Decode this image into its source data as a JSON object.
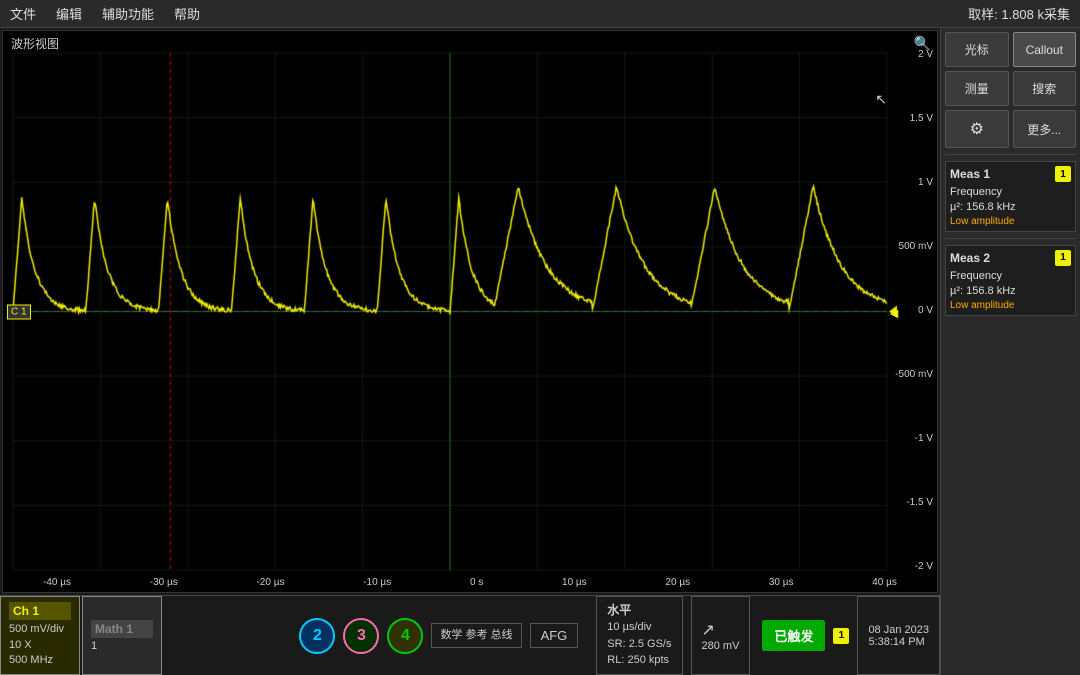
{
  "menubar": {
    "file": "文件",
    "edit": "编辑",
    "tools": "辅助功能",
    "help": "帮助",
    "sample_info": "取样: 1.808 k采集"
  },
  "waveform": {
    "title": "波形视图",
    "y_labels": [
      "2 V",
      "1.5 V",
      "1 V",
      "500 mV",
      "0 V",
      "-500 mV",
      "-1 V",
      "-1.5 V",
      "-2 V"
    ],
    "x_labels": [
      "-40 µs",
      "-30 µs",
      "-20 µs",
      "-10 µs",
      "0 s",
      "10 µs",
      "20 µs",
      "30 µs",
      "40 µs"
    ],
    "ch1_label": "C 1",
    "trigger_label": "T"
  },
  "right_panel": {
    "cursor_btn": "光标",
    "callout_btn": "Callout",
    "measure_btn": "测量",
    "search_btn": "搜索",
    "display_btn": "⚙",
    "more_btn": "更多...",
    "meas1_title": "Meas 1",
    "meas1_badge": "1",
    "meas1_param": "Frequency",
    "meas1_value": "µ²: 156.8 kHz",
    "meas1_warning": "Low amplitude",
    "meas2_title": "Meas 2",
    "meas2_badge": "1",
    "meas2_param": "Frequency",
    "meas2_value": "µ²: 156.8 kHz",
    "meas2_warning": "Low amplitude"
  },
  "bottom_bar": {
    "ch1_header": "Ch 1",
    "ch1_line1": "500 mV/div",
    "ch1_line2": "10 X",
    "ch1_line3": "500 MHz",
    "math_header": "Math 1",
    "math_value": "1",
    "ch2_label": "2",
    "ch3_label": "3",
    "ch4_label": "4",
    "math_ref_bus": "数学\n参考\n总线",
    "afg_label": "AFG",
    "horizontal_title": "水平",
    "horizontal_line1": "10 µs/div",
    "horizontal_line2": "SR: 2.5 GS/s",
    "horizontal_line3": "RL: 250 kpts",
    "trigger_symbol": "↗",
    "trigger_value": "280 mV",
    "triggered_label": "已触发",
    "trigger_badge": "1",
    "date": "08 Jan 2023",
    "time": "5:38:14 PM"
  }
}
